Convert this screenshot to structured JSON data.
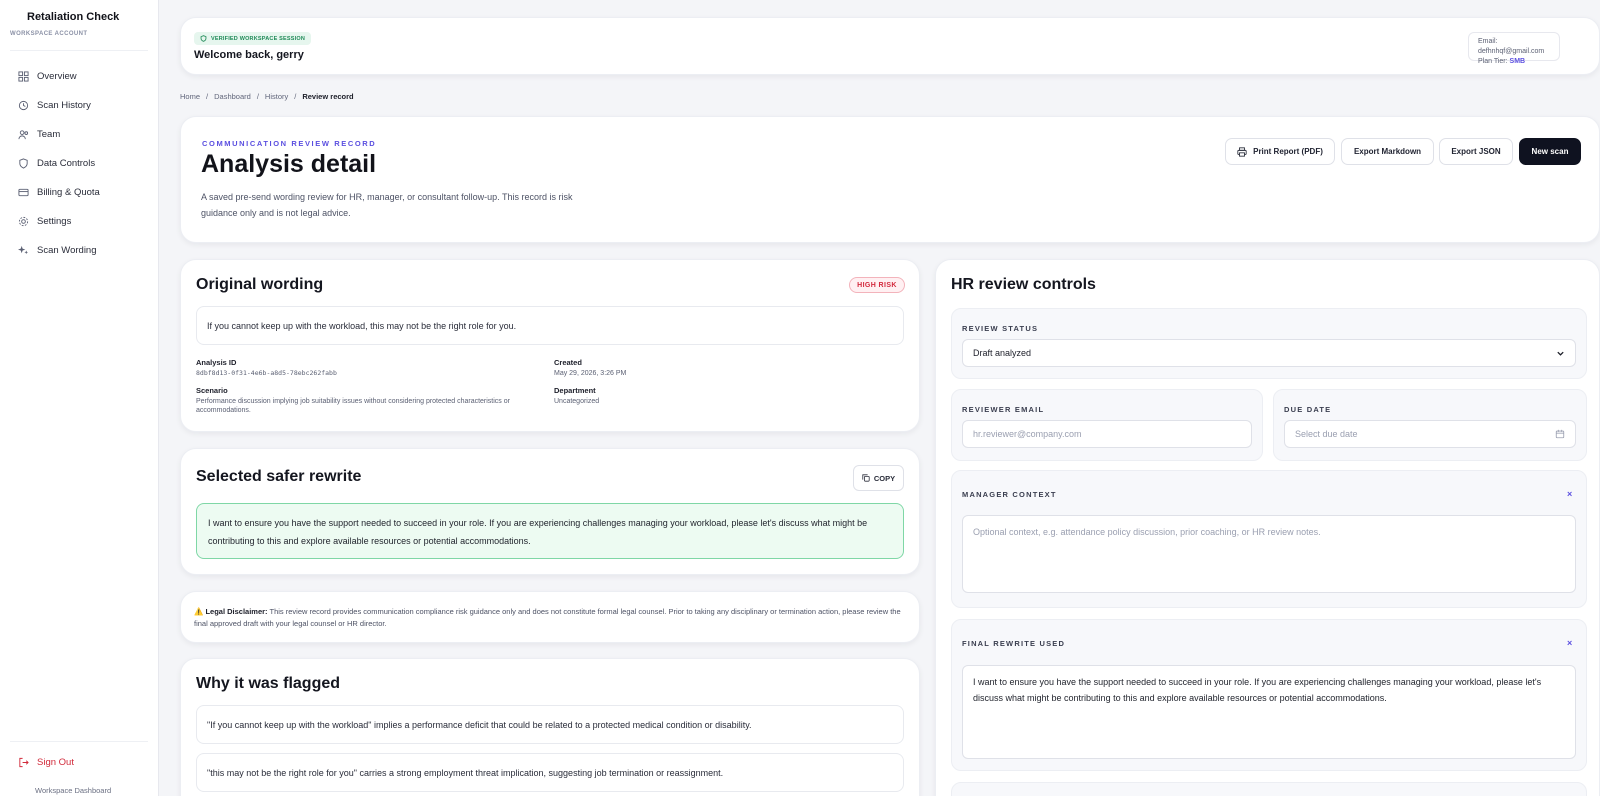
{
  "sidebar": {
    "brand": "Retaliation Check",
    "subtitle": "WORKSPACE ACCOUNT",
    "items": [
      {
        "label": "Overview",
        "icon": "grid-icon"
      },
      {
        "label": "Scan History",
        "icon": "history-icon"
      },
      {
        "label": "Team",
        "icon": "users-icon"
      },
      {
        "label": "Data Controls",
        "icon": "shield-icon"
      },
      {
        "label": "Billing & Quota",
        "icon": "credit-card-icon"
      },
      {
        "label": "Settings",
        "icon": "gear-icon"
      },
      {
        "label": "Scan Wording",
        "icon": "sparkle-icon"
      }
    ],
    "sign_out": "Sign Out",
    "workspace_dashboard": "Workspace Dashboard"
  },
  "header": {
    "badge": "VERIFIED WORKSPACE SESSION",
    "welcome": "Welcome back, gerry",
    "email_label": "Email:",
    "email": "defhnhqf@gmail.com",
    "plan_label": "Plan Tier:",
    "plan": "SMB"
  },
  "breadcrumb": [
    "Home",
    "Dashboard",
    "History",
    "Review record"
  ],
  "record": {
    "eyebrow": "COMMUNICATION REVIEW RECORD",
    "title": "Analysis detail",
    "description": "A saved pre-send wording review for HR, manager, or consultant follow-up. This record is risk guidance only and is not legal advice.",
    "buttons": {
      "print": "Print Report (PDF)",
      "markdown": "Export Markdown",
      "json": "Export JSON",
      "new_scan": "New scan"
    }
  },
  "original": {
    "title": "Original wording",
    "risk": "HIGH RISK",
    "text": "If you cannot keep up with the workload, this may not be the right role for you.",
    "analysis_id_label": "Analysis ID",
    "analysis_id": "8dbf8d13-0f31-4e6b-a8d5-78ebc262fabb",
    "created_label": "Created",
    "created": "May 29, 2026, 3:26 PM",
    "scenario_label": "Scenario",
    "scenario": "Performance discussion implying job suitability issues without considering protected characteristics or accommodations.",
    "department_label": "Department",
    "department": "Uncategorized"
  },
  "rewrite": {
    "title": "Selected safer rewrite",
    "copy": "COPY",
    "text": "I want to ensure you have the support needed to succeed in your role. If you are experiencing challenges managing your workload, please let's discuss what might be contributing to this and explore available resources or potential accommodations."
  },
  "disclaimer": {
    "label": "Legal Disclaimer:",
    "text": "This review record provides communication compliance risk guidance only and does not constitute formal legal counsel. Prior to taking any disciplinary or termination action, please review the final approved draft with your legal counsel or HR director."
  },
  "flagged": {
    "title": "Why it was flagged",
    "reasons": [
      "\"If you cannot keep up with the workload\" implies a performance deficit that could be related to a protected medical condition or disability.",
      "\"this may not be the right role for you\" carries a strong employment threat implication, suggesting job termination or reassignment."
    ]
  },
  "hr": {
    "title": "HR review controls",
    "review_status_label": "REVIEW STATUS",
    "review_status": "Draft analyzed",
    "reviewer_email_label": "REVIEWER EMAIL",
    "reviewer_email_placeholder": "hr.reviewer@company.com",
    "due_date_label": "DUE DATE",
    "due_date_placeholder": "Select due date",
    "manager_context_label": "MANAGER CONTEXT",
    "manager_context_placeholder": "Optional context, e.g. attendance policy discussion, prior coaching, or HR review notes.",
    "final_rewrite_label": "FINAL REWRITE USED",
    "final_rewrite": "I want to ensure you have the support needed to succeed in your role. If you are experiencing challenges managing your workload, please let's discuss what might be contributing to this and explore available resources or potential accommodations.",
    "clear_mark": "×"
  },
  "colors": {
    "accent": "#5b4fe0",
    "danger": "#d3283c",
    "success_bg": "#edfbf2",
    "dark": "#0f1220"
  }
}
